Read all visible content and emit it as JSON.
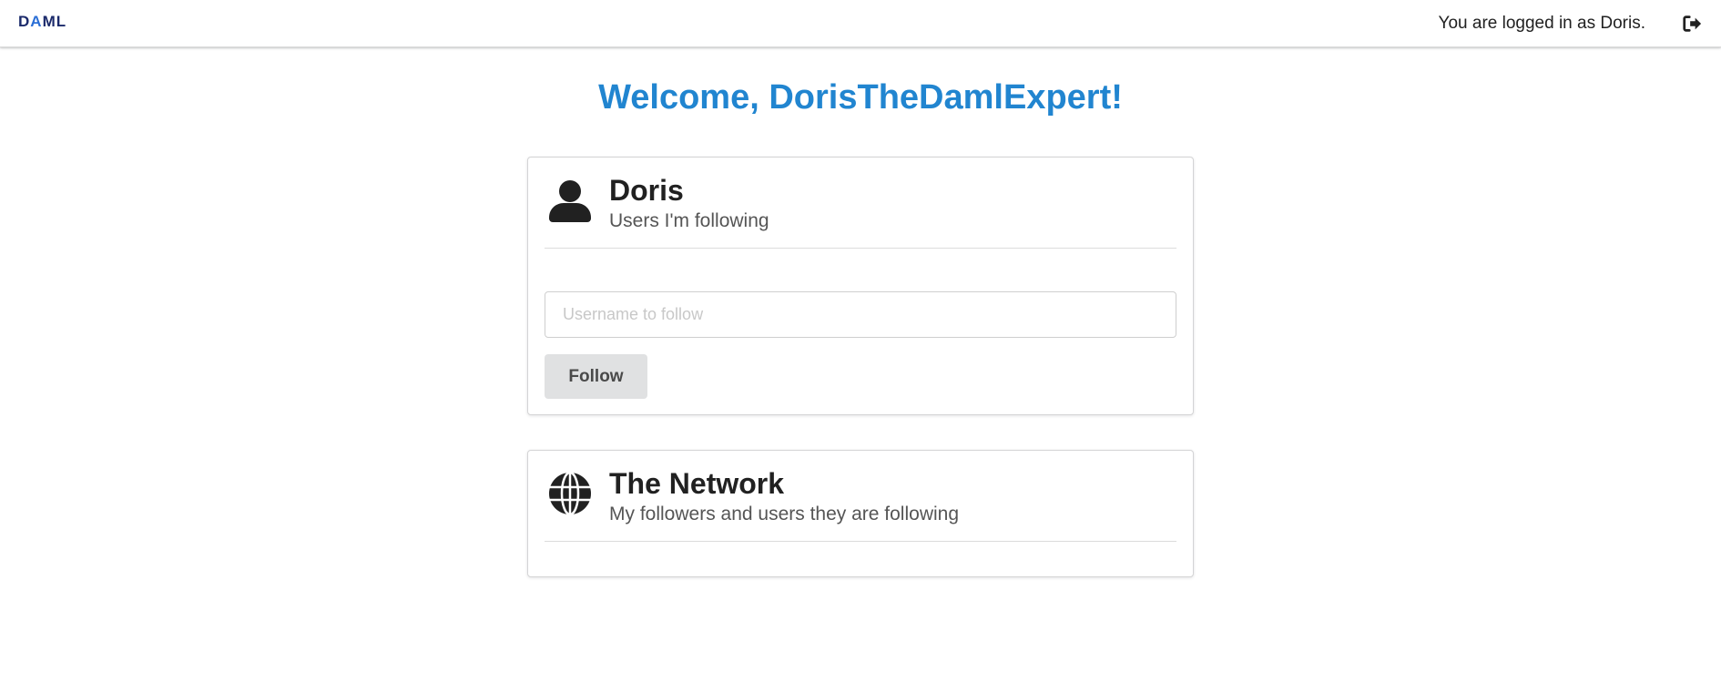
{
  "topbar": {
    "logo_left": "D",
    "logo_mark": "A",
    "logo_right": "ML",
    "login_text": "You are logged in as Doris.",
    "logout_icon": "sign-out-icon"
  },
  "welcome": "Welcome, DorisTheDamlExpert!",
  "following_card": {
    "icon": "user-icon",
    "title": "Doris",
    "subtitle": "Users I'm following",
    "input_placeholder": "Username to follow",
    "input_value": "",
    "follow_label": "Follow"
  },
  "network_card": {
    "icon": "globe-icon",
    "title": "The Network",
    "subtitle": "My followers and users they are following"
  },
  "colors": {
    "accent": "#2185d0",
    "logo": "#1b2a6b",
    "button_bg": "#e0e1e2"
  }
}
